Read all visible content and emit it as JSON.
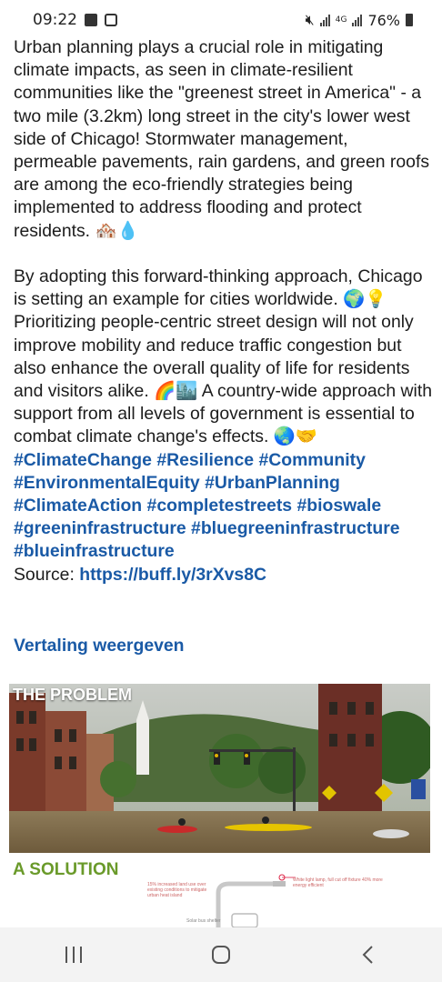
{
  "status_bar": {
    "time": "09:22",
    "battery": "76%",
    "network": "4G",
    "left_icons": [
      "gallery-icon",
      "notification-icon"
    ],
    "right_icons": [
      "mute-icon",
      "signal-icon",
      "signal-icon"
    ]
  },
  "post": {
    "paragraph_1": "Urban planning plays a crucial role in mitigating climate impacts, as seen in climate-resilient communities like the \"greenest street in America\" - a two mile (3.2km) long street in the city's lower west side of Chicago! Stormwater management, permeable pavements, rain gardens, and green roofs are among the eco-friendly strategies being implemented to address flooding and protect residents. 🏘️💧",
    "paragraph_2": "By adopting this forward-thinking approach, Chicago is setting an example for cities worldwide. 🌍💡 Prioritizing people-centric street design will not only improve mobility and reduce traffic congestion but also enhance the overall quality of life for residents and visitors alike. 🌈🏙️ A country-wide approach with support from all levels of government is essential to combat climate change's effects. 🌏🤝",
    "hashtags": [
      "#ClimateChange",
      "#Resilience",
      "#Community",
      "#EnvironmentalEquity",
      "#UrbanPlanning",
      "#ClimateAction",
      "#completestreets",
      "#bioswale",
      "#greeninfrastructure",
      "#bluegreeninfrastructure",
      "#blueinfrastructure"
    ],
    "source_label": "Source:",
    "source_link": "https://buff.ly/3rXvs8C",
    "translate_label": "Vertaling weergeven"
  },
  "media": {
    "problem_label": "THE PROBLEM",
    "solution_label": "A SOLUTION",
    "note_left": "15% increased land use over existing conditions to mitigate urban heat island",
    "note_right": "White light lamp, full cut off fixture 40% more energy efficient",
    "note_bottom": "Solar bus shelter"
  },
  "nav_bar": {
    "buttons": [
      "recent-apps-icon",
      "home-icon",
      "back-icon"
    ]
  },
  "colors": {
    "link": "#1a5aa6",
    "solution_green": "#6a9a2a",
    "text": "#1c1c1c"
  }
}
